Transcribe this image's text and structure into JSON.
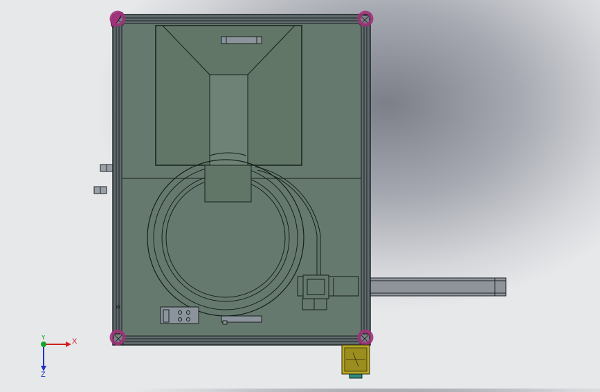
{
  "viewport": {
    "background_center": "#7c7f88",
    "background_edge": "#e7e8ea",
    "model_fill": "#66796f",
    "frame_fill": "#5f6a6c",
    "caster_color": "#a0337a",
    "motor_color": "#b8a827"
  },
  "triad": {
    "x_label": "X",
    "y_label": "Y",
    "z_label": "Z",
    "x_color": "#d11f1f",
    "y_color": "#17a32a",
    "z_color": "#2033c4"
  }
}
